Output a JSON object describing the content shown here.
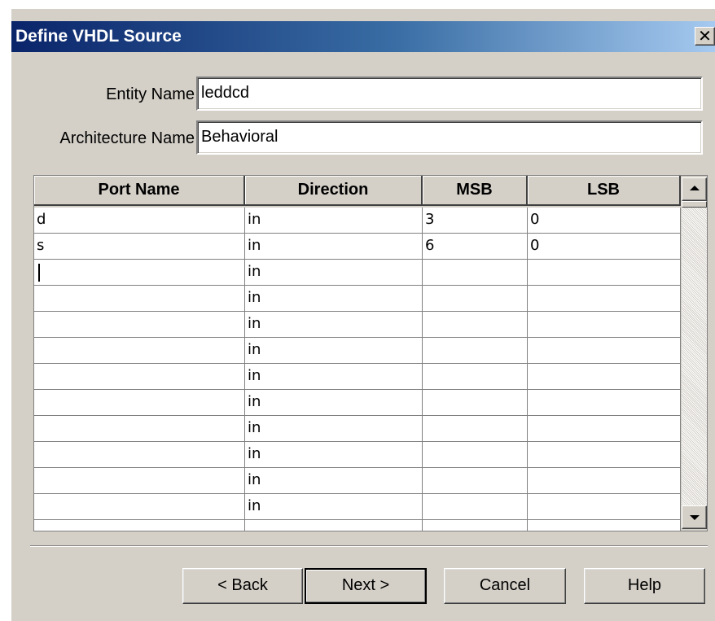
{
  "window": {
    "title": "Define VHDL Source",
    "close_glyph": "✕"
  },
  "form": {
    "entity_label": "Entity Name",
    "entity_value": "leddcd",
    "architecture_label": "Architecture Name",
    "architecture_value": "Behavioral"
  },
  "ports_table": {
    "columns": [
      "Port Name",
      "Direction",
      "MSB",
      "LSB"
    ],
    "rows": [
      {
        "port": "d",
        "direction": "in",
        "msb": "3",
        "lsb": "0"
      },
      {
        "port": "s",
        "direction": "in",
        "msb": "6",
        "lsb": "0"
      },
      {
        "port": "",
        "direction": "in",
        "msb": "",
        "lsb": "",
        "editing": true
      },
      {
        "port": "",
        "direction": "in",
        "msb": "",
        "lsb": ""
      },
      {
        "port": "",
        "direction": "in",
        "msb": "",
        "lsb": ""
      },
      {
        "port": "",
        "direction": "in",
        "msb": "",
        "lsb": ""
      },
      {
        "port": "",
        "direction": "in",
        "msb": "",
        "lsb": ""
      },
      {
        "port": "",
        "direction": "in",
        "msb": "",
        "lsb": ""
      },
      {
        "port": "",
        "direction": "in",
        "msb": "",
        "lsb": ""
      },
      {
        "port": "",
        "direction": "in",
        "msb": "",
        "lsb": ""
      },
      {
        "port": "",
        "direction": "in",
        "msb": "",
        "lsb": ""
      },
      {
        "port": "",
        "direction": "in",
        "msb": "",
        "lsb": ""
      },
      {
        "port": "",
        "direction": "",
        "msb": "",
        "lsb": ""
      }
    ],
    "scrollbar": {
      "up_icon": "scroll-up-arrow-icon",
      "down_icon": "scroll-down-arrow-icon"
    }
  },
  "buttons": {
    "back": "< Back",
    "next": "Next >",
    "cancel": "Cancel",
    "help": "Help"
  },
  "colors": {
    "dialog_face": "#d4d0c8",
    "title_gradient_start": "#0a246a",
    "title_gradient_end": "#a6caf0",
    "title_text": "#ffffff"
  }
}
